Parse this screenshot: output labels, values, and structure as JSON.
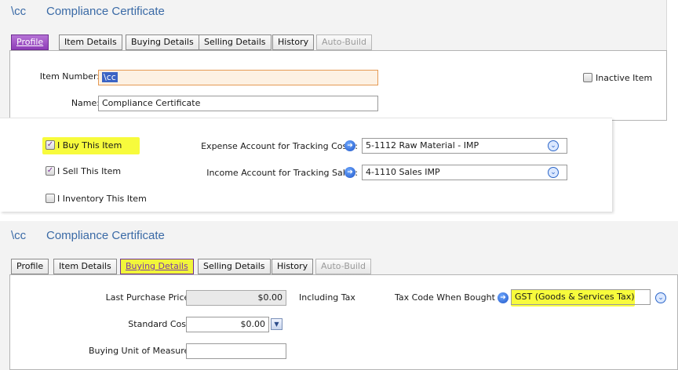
{
  "top": {
    "item_code": "\\cc",
    "item_name": "Compliance Certificate",
    "tabs": [
      {
        "label": "Profile"
      },
      {
        "label": "Item Details"
      },
      {
        "label": "Buying Details"
      },
      {
        "label": "Selling Details"
      },
      {
        "label": "History"
      },
      {
        "label": "Auto-Build"
      }
    ],
    "item_number_label": "Item Number:",
    "item_number_value": "\\cc",
    "name_label": "Name:",
    "name_value": "Compliance Certificate",
    "inactive_label": "Inactive Item"
  },
  "mid": {
    "buy_label": "I Buy This Item",
    "sell_label": "I Sell This Item",
    "inventory_label": "I Inventory This Item",
    "expense_label": "Expense Account for Tracking Costs:",
    "expense_value": "5-1112 Raw Material - IMP",
    "income_label": "Income Account for Tracking Sales:",
    "income_value": "4-1110 Sales IMP"
  },
  "bottom": {
    "item_code": "\\cc",
    "item_name": "Compliance Certificate",
    "tabs": [
      {
        "label": "Profile"
      },
      {
        "label": "Item Details"
      },
      {
        "label": "Buying Details"
      },
      {
        "label": "Selling Details"
      },
      {
        "label": "History"
      },
      {
        "label": "Auto-Build"
      }
    ],
    "last_price_label": "Last Purchase Price:",
    "last_price_value": "$0.00",
    "including_tax_label": "Including Tax",
    "tax_code_label": "Tax Code When Bought",
    "tax_code_value": "GST (Goods & Services Tax)",
    "standard_cost_label": "Standard Cost:",
    "standard_cost_value": "$0.00",
    "unit_measure_label": "Buying Unit of Measure:",
    "unit_measure_value": ""
  },
  "colors": {
    "accent_purple": "#8e3cb8",
    "title_blue": "#3a6aa6",
    "highlight_yellow": "#f7fb3c",
    "focus_orange": "#e59a54"
  }
}
